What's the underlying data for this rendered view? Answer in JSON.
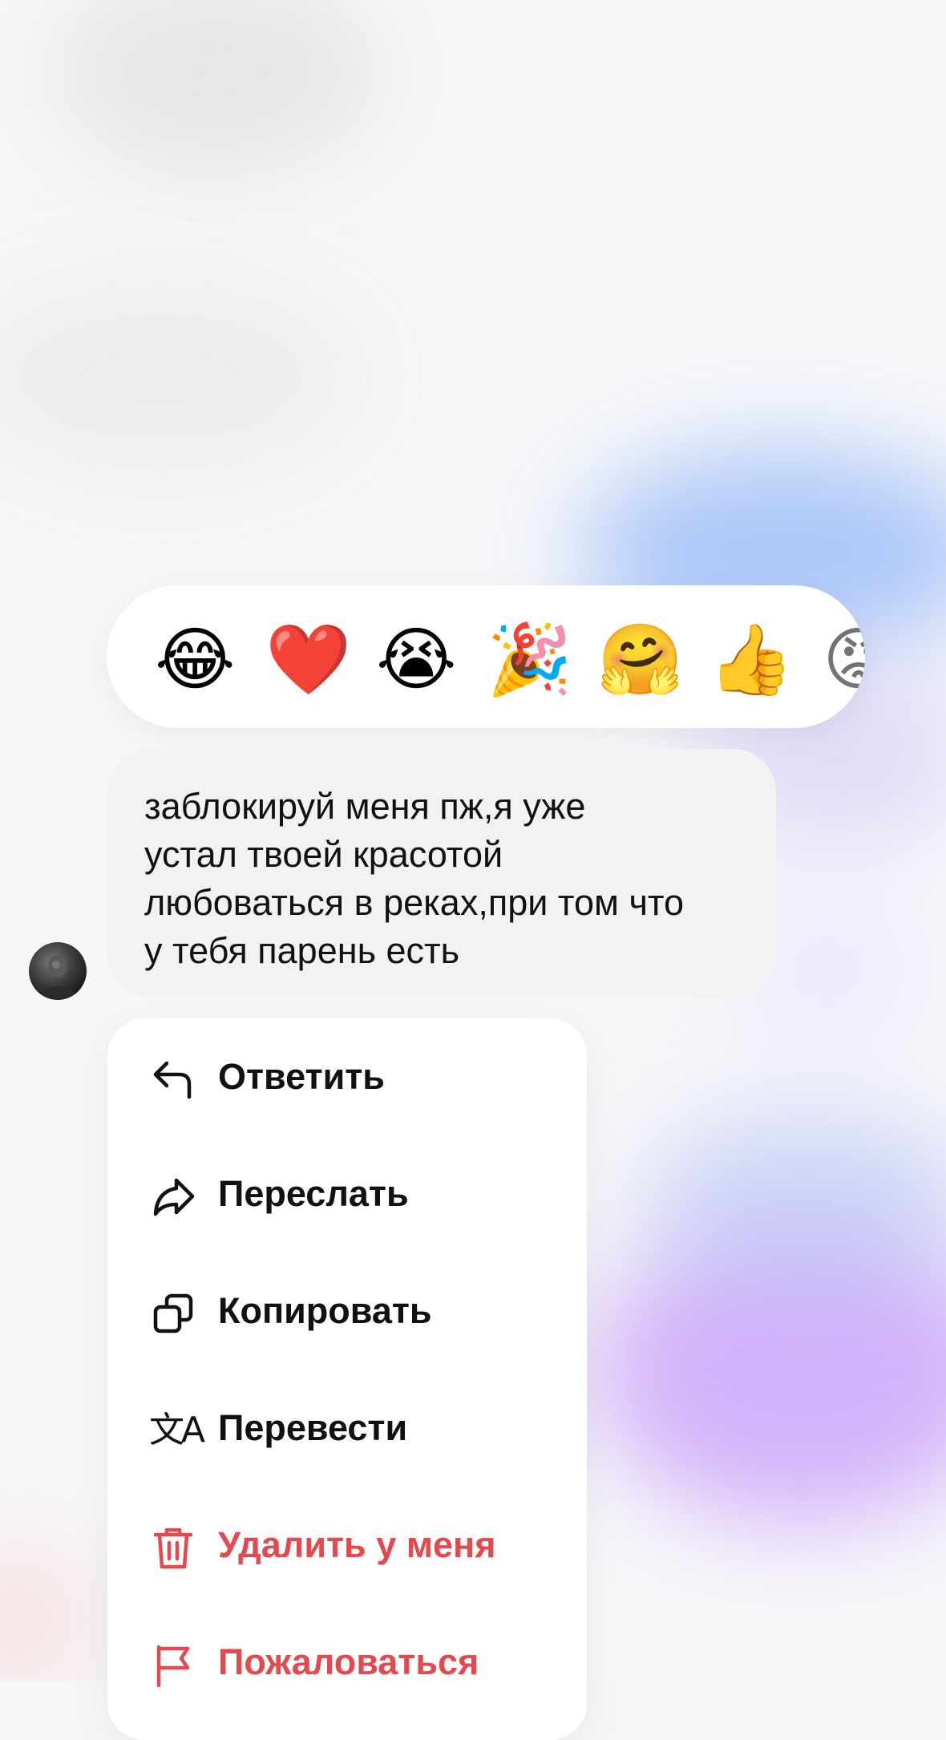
{
  "reactions": [
    {
      "emoji": "😂",
      "name": "tears-of-joy"
    },
    {
      "emoji": "❤️",
      "name": "red-heart"
    },
    {
      "emoji": "😭",
      "name": "loudly-crying"
    },
    {
      "emoji": "🎉",
      "name": "party-popper"
    },
    {
      "emoji": "🤗",
      "name": "hugging-face"
    },
    {
      "emoji": "👍",
      "name": "thumbs-up"
    },
    {
      "emoji": "😡",
      "name": "angry-face"
    }
  ],
  "message": {
    "text": "заблокируй меня пж,я уже\nустал твоей красотой\nлюбоваться в реках,при том что\nу тебя парень есть"
  },
  "menu": {
    "reply": "Ответить",
    "forward": "Переслать",
    "copy": "Копировать",
    "translate": "Перевести",
    "delete": "Удалить у меня",
    "report": "Пожаловаться"
  },
  "colors": {
    "danger": "#e5484d",
    "bubble": "#f2f2f3",
    "text": "#111111"
  }
}
